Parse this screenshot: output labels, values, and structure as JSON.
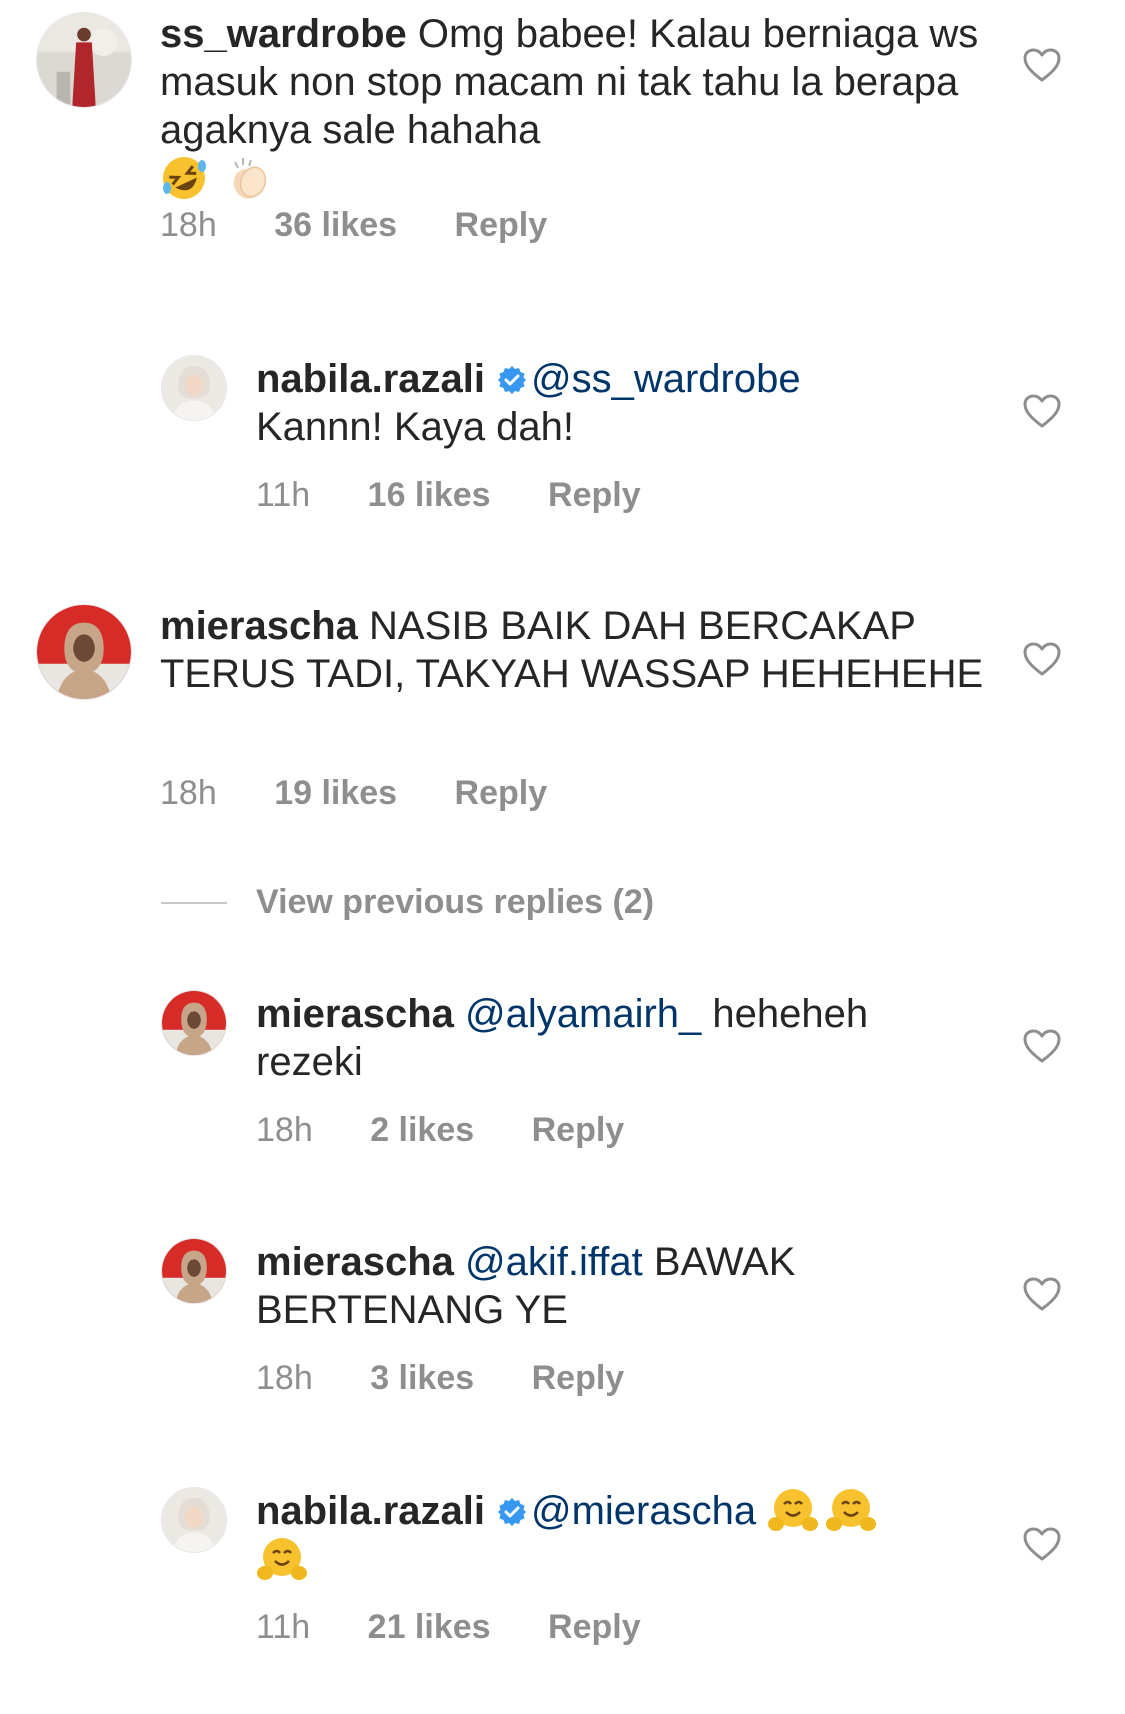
{
  "comments": [
    {
      "username": "ss_wardrobe",
      "text": "Omg babee! Kalau berniaga ws masuk non stop macam ni tak tahu la berapa agaknya sale hahaha",
      "emojis": [
        "rolling-laughing-emoji",
        "clapping-hands-emoji"
      ],
      "time": "18h",
      "likes": "36 likes",
      "reply_label": "Reply"
    },
    {
      "username": "nabila.razali",
      "verified": true,
      "mention": "@ss_wardrobe",
      "text": "Kannn! Kaya dah!",
      "time": "11h",
      "likes": "16 likes",
      "reply_label": "Reply"
    },
    {
      "username": "mierascha",
      "text": "NASIB BAIK DAH BERCAKAP TERUS TADI, TAKYAH WASSAP HEHEHEHE",
      "time": "18h",
      "likes": "19 likes",
      "reply_label": "Reply"
    },
    {
      "username": "mierascha",
      "mention": "@alyamairh_",
      "text": "heheheh rezeki",
      "time": "18h",
      "likes": "2 likes",
      "reply_label": "Reply"
    },
    {
      "username": "mierascha",
      "mention": "@akif.iffat",
      "text": "BAWAK BERTENANG YE",
      "time": "18h",
      "likes": "3 likes",
      "reply_label": "Reply"
    },
    {
      "username": "nabila.razali",
      "verified": true,
      "mention": "@mierascha",
      "emojis": [
        "hugging-face-emoji",
        "hugging-face-emoji",
        "hugging-face-emoji"
      ],
      "time": "11h",
      "likes": "21 likes",
      "reply_label": "Reply"
    }
  ],
  "view_previous_replies": "View previous replies (2)",
  "colors": {
    "text": "#262626",
    "mention": "#003569",
    "meta": "#8e8e8e",
    "verified": "#3897f0"
  }
}
